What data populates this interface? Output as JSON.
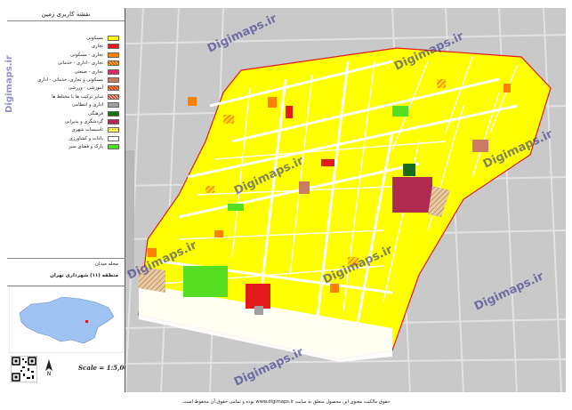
{
  "legend": {
    "title": "نقشه کاربری زمین",
    "items": [
      {
        "label": "مسکونی",
        "color": "#ffff00",
        "pattern": "solid"
      },
      {
        "label": "تجاری",
        "color": "#e31a1c",
        "pattern": "solid"
      },
      {
        "label": "تجاری - مسکونی",
        "color": "#ff7f00",
        "pattern": "solid"
      },
      {
        "label": "تجاری - اداری - خدماتی",
        "color": "#ffd700",
        "pattern": "hatch"
      },
      {
        "label": "تجاری - صنعتی",
        "color": "#d62f5e",
        "pattern": "solid"
      },
      {
        "label": "مسکونی و تجاری، خدماتی - اداری",
        "color": "#c97b63",
        "pattern": "solid"
      },
      {
        "label": "آموزشی - ورزشی",
        "color": "#e8a040",
        "pattern": "hatch"
      },
      {
        "label": "سایر ترکیب ها یا مختلط ها",
        "color": "#d9c8a0",
        "pattern": "hatch"
      },
      {
        "label": "اداری و انتظامی",
        "color": "#a0a0a0",
        "pattern": "solid"
      },
      {
        "label": "فرهنگی",
        "color": "#1a6b1a",
        "pattern": "solid"
      },
      {
        "label": "گردشگری و پذیرایی",
        "color": "#b0294f",
        "pattern": "solid"
      },
      {
        "label": "تاسیسات شهری",
        "color": "#ff6600",
        "pattern": "dots"
      },
      {
        "label": "باغات و کشاورزی",
        "color": "#ffffff",
        "pattern": "solid"
      },
      {
        "label": "پارک و فضای سبز",
        "color": "#55dd22",
        "pattern": "solid"
      }
    ]
  },
  "watermark": "Digimaps.ir",
  "district": {
    "name": "محله میدان",
    "subtitle": "منطقه (۱۱) شهرداری تهران"
  },
  "scale": "Scale = 1:5,000",
  "north_label": "N",
  "footer": "حقوق مالکیت معنوی این محصول متعلق به سایت www.digimaps.ir بوده و تمامی حقوق آن محفوظ است.",
  "colors": {
    "residential": "#ffff00",
    "road": "#ffffff",
    "background": "#c9c9c9",
    "boundary": "#e31a1c",
    "commercial": "#e31a1c",
    "park": "#55dd22",
    "tourism": "#b0294f",
    "culture": "#1a6b1a"
  }
}
